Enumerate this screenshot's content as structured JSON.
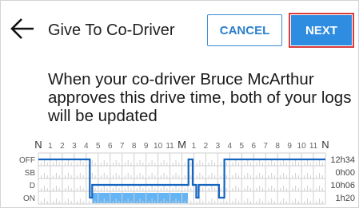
{
  "header": {
    "title": "Give To Co-Driver",
    "cancel_label": "CANCEL",
    "next_label": "NEXT"
  },
  "message": "When your co-driver Bruce McArthur approves this drive time, both of your logs will be updated",
  "chart_data": {
    "type": "line",
    "title": "",
    "hour_labels": [
      "N",
      "1",
      "2",
      "3",
      "4",
      "5",
      "6",
      "7",
      "8",
      "9",
      "10",
      "11",
      "M",
      "1",
      "2",
      "3",
      "4",
      "5",
      "6",
      "7",
      "8",
      "9",
      "10",
      "11",
      "N"
    ],
    "rows": [
      "OFF",
      "SB",
      "D",
      "ON"
    ],
    "totals": [
      "12h34",
      "0h00",
      "10h06",
      "1h20"
    ],
    "segments": [
      {
        "status": "OFF",
        "start": 0,
        "end": 4.3
      },
      {
        "status": "ON",
        "start": 4.3,
        "end": 4.5
      },
      {
        "status": "D",
        "start": 4.5,
        "end": 12.55
      },
      {
        "status": "OFF",
        "start": 12.55,
        "end": 12.9
      },
      {
        "status": "D",
        "start": 12.9,
        "end": 13.2
      },
      {
        "status": "ON",
        "start": 13.2,
        "end": 13.4
      },
      {
        "status": "D",
        "start": 13.4,
        "end": 15.1
      },
      {
        "status": "ON",
        "start": 15.1,
        "end": 15.55
      },
      {
        "status": "OFF",
        "start": 15.55,
        "end": 24
      }
    ],
    "highlight": {
      "row": "ON",
      "start": 4.5,
      "end": 12.5
    },
    "colors": {
      "line": "#1565c0",
      "highlight": "#64b5f6",
      "grid": "#cfcfcf",
      "label": "#555555"
    }
  }
}
